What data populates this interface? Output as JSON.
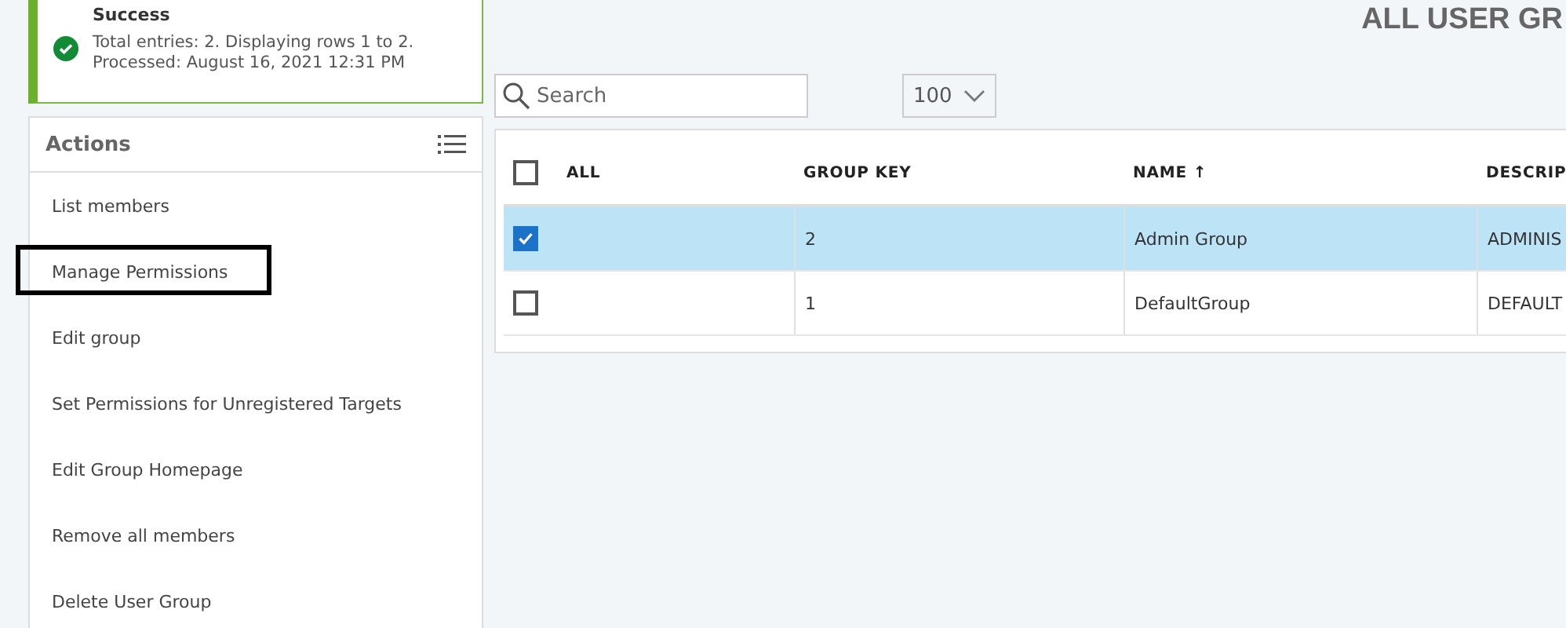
{
  "notification": {
    "title": "Success",
    "lines": [
      "Total entries: 2. Displaying rows 1 to 2.",
      "Processed: August 16, 2021 12:31 PM"
    ]
  },
  "actions": {
    "title": "Actions",
    "items": [
      {
        "label": "List members",
        "highlighted": false
      },
      {
        "label": "Manage Permissions",
        "highlighted": true
      },
      {
        "label": "Edit group",
        "highlighted": false
      },
      {
        "label": "Set Permissions for Unregistered Targets",
        "highlighted": false
      },
      {
        "label": "Edit Group Homepage",
        "highlighted": false
      },
      {
        "label": "Remove all members",
        "highlighted": false
      },
      {
        "label": "Delete User Group",
        "highlighted": false
      }
    ]
  },
  "page_title": "ALL USER GR",
  "search": {
    "placeholder": "Search"
  },
  "page_size": "100",
  "table": {
    "select_all": {
      "label": "ALL",
      "checked": false
    },
    "columns": [
      "GROUP KEY",
      "NAME ↑",
      "DESCRIP"
    ],
    "rows": [
      {
        "selected": true,
        "cells": [
          "2",
          "Admin Group",
          "ADMINIS"
        ]
      },
      {
        "selected": false,
        "cells": [
          "1",
          "DefaultGroup",
          "DEFAULT"
        ]
      }
    ]
  }
}
